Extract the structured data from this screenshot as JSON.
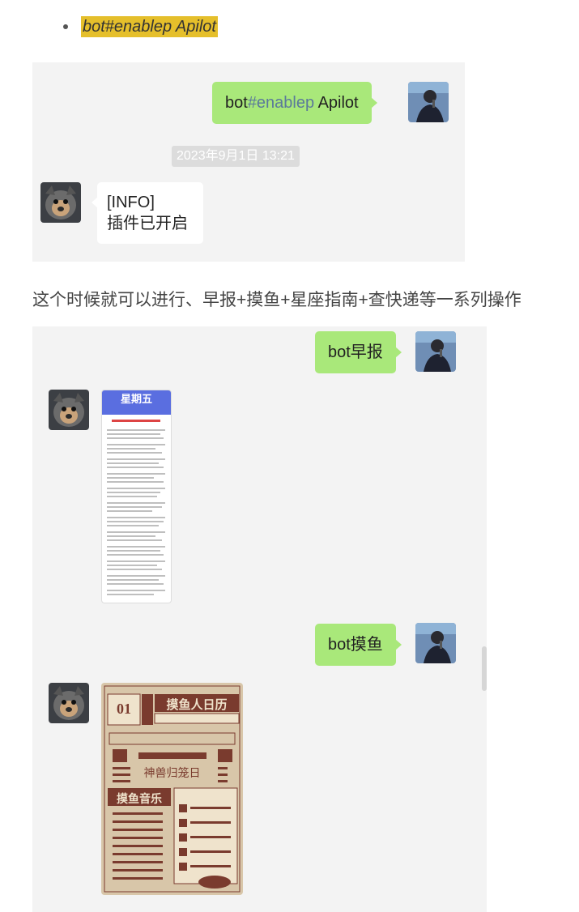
{
  "bullet": {
    "text": "bot#enablep Apilot"
  },
  "chat1": {
    "outgoing": {
      "prefix": "bot",
      "keyword": "#enablep",
      "suffix": " Apilot"
    },
    "timestamp": "2023年9月1日 13:21",
    "reply": {
      "line1": "[INFO]",
      "line2": "插件已开启"
    }
  },
  "paragraph": "这个时候就可以进行、早报+摸鱼+星座指南+查快递等一系列操作",
  "chat2": {
    "msg1": "bot早报",
    "image1": {
      "header": "星期五"
    },
    "msg2": "bot摸鱼",
    "image2": {
      "date_num": "01",
      "title": "摸鱼人日历",
      "center_text": "神兽归笼日",
      "section": "摸鱼音乐"
    }
  },
  "colors": {
    "bubble_green": "#a9e87a",
    "highlight": "#e5bf2b",
    "chat_bg": "#f3f3f3",
    "keyword": "#5b7a9a"
  },
  "icons": [
    "user-avatar-icon",
    "bot-avatar-icon"
  ]
}
